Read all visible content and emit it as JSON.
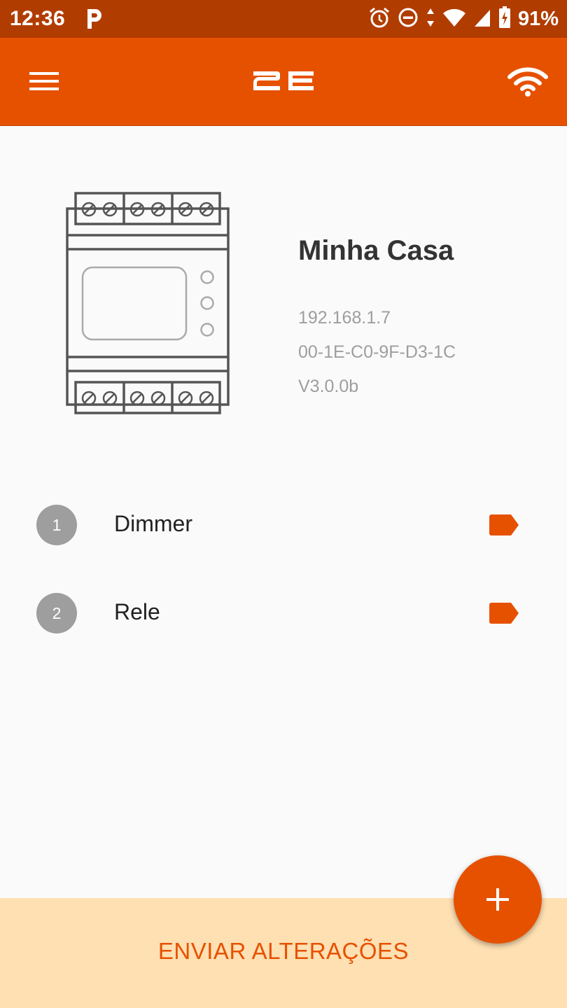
{
  "status_bar": {
    "time": "12:36",
    "battery": "91%",
    "icons": [
      "parking-icon",
      "alarm-icon",
      "do-not-disturb-icon",
      "data-arrows-icon",
      "wifi-signal-icon",
      "cell-signal-icon",
      "battery-charging-icon"
    ]
  },
  "app_bar": {
    "menu_icon": "hamburger-menu-icon",
    "logo": "2E",
    "wifi_icon": "wifi-icon",
    "color": "#e65100"
  },
  "device": {
    "name": "Minha Casa",
    "ip": "192.168.1.7",
    "mac": "00-1E-C0-9F-D3-1C",
    "version": "V3.0.0b"
  },
  "channels": [
    {
      "number": "1",
      "label": "Dimmer",
      "icon": "label-tag-icon"
    },
    {
      "number": "2",
      "label": "Rele",
      "icon": "label-tag-icon"
    }
  ],
  "actions": {
    "send_label": "ENVIAR ALTERAÇÕES",
    "fab_icon": "plus-icon"
  },
  "colors": {
    "accent": "#e65100",
    "status_bar": "#b13c00",
    "bottom_bar": "#ffe0b2"
  }
}
